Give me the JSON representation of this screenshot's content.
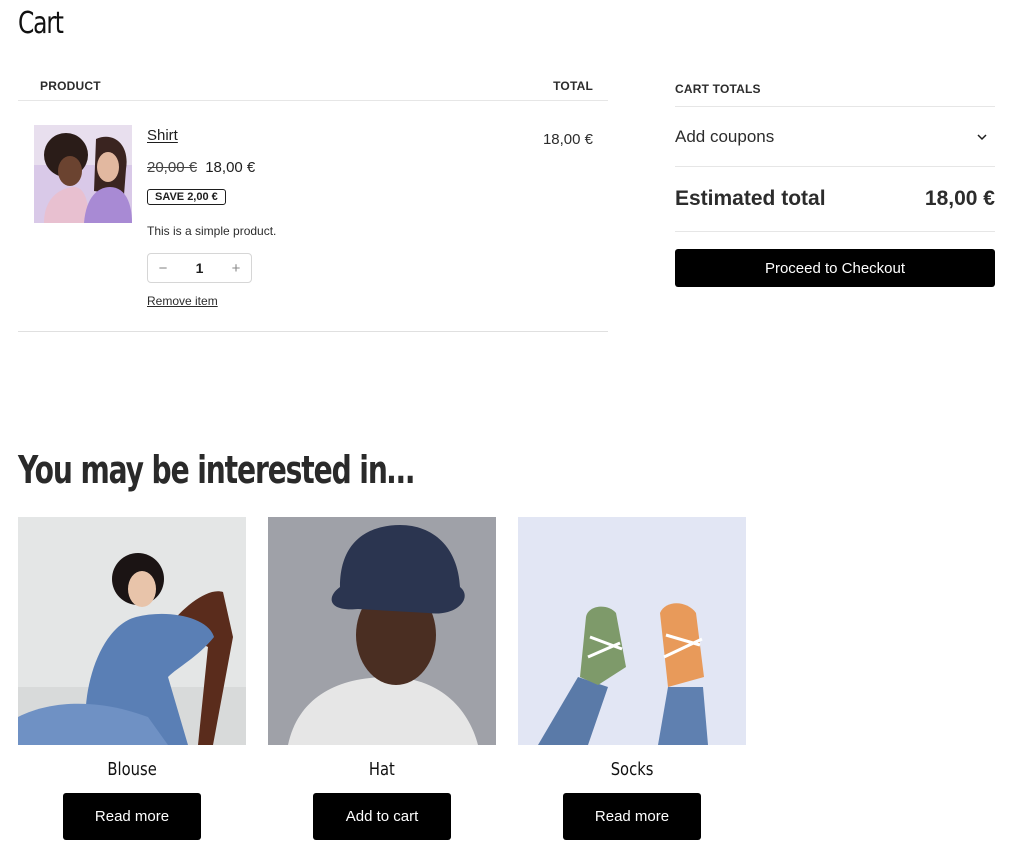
{
  "page": {
    "title": "Cart"
  },
  "cart_table": {
    "col_product": "PRODUCT",
    "col_total": "TOTAL",
    "items": [
      {
        "name": "Shirt",
        "price_old": "20,00 €",
        "price_new": "18,00 €",
        "badge": "SAVE 2,00 €",
        "description": "This is a simple product.",
        "quantity": "1",
        "qty_minus": "−",
        "qty_plus": "+",
        "remove_label": "Remove item",
        "line_total": "18,00 €"
      }
    ]
  },
  "cart_totals": {
    "heading": "CART TOTALS",
    "coupons_label": "Add coupons",
    "estimated_label": "Estimated total",
    "estimated_value": "18,00 €",
    "checkout_label": "Proceed to Checkout"
  },
  "related": {
    "title": "You may be interested in…",
    "products": [
      {
        "name": "Blouse",
        "button": "Read more"
      },
      {
        "name": "Hat",
        "button": "Add to cart"
      },
      {
        "name": "Socks",
        "button": "Read more"
      }
    ]
  },
  "colors": {
    "button_bg": "#000000",
    "button_text": "#ffffff",
    "divider": "#e6e6e6"
  }
}
